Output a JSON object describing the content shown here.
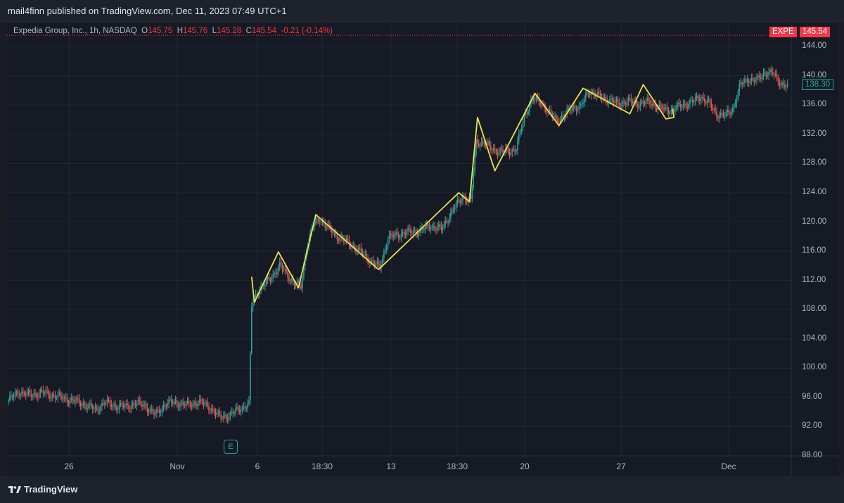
{
  "header": {
    "published": "mail4finn published on TradingView.com, Dec 11, 2023 07:49 UTC+1"
  },
  "legend": {
    "symbol": "Expedia Group, Inc., 1h, NASDAQ",
    "o_label": "O",
    "o": "145.75",
    "h_label": "H",
    "h": "145.76",
    "l_label": "L",
    "l": "145.28",
    "c_label": "C",
    "c": "145.54",
    "change": "-0.21 (-0.14%)"
  },
  "tags": {
    "ticker": "EXPE",
    "last_price": "145.54",
    "cursor_price": "138.30"
  },
  "colors": {
    "up": "#26a69a",
    "down": "#ef5350",
    "zigzag": "#e8e24a",
    "grid": "#232633",
    "price_line": "#f23645"
  },
  "earnings_marker": "E",
  "footer": {
    "brand": "TradingView"
  },
  "chart_data": {
    "type": "candlestick",
    "title": "Expedia Group, Inc., 1h, NASDAQ",
    "y_ticks": [
      "144.00",
      "140.00",
      "136.00",
      "132.00",
      "128.00",
      "124.00",
      "120.00",
      "116.00",
      "112.00",
      "108.00",
      "104.00",
      "100.00",
      "96.00",
      "92.00",
      "88.00"
    ],
    "x_ticks": [
      "26",
      "Nov",
      "6",
      "18:30",
      "13",
      "18:30",
      "20",
      "27",
      "Dec"
    ],
    "ylim": [
      88,
      145.5
    ],
    "last_price": 145.54,
    "approx_close_path": [
      {
        "x": 0,
        "y": 95.6
      },
      {
        "x": 8,
        "y": 96.8
      },
      {
        "x": 16,
        "y": 96.3
      },
      {
        "x": 25,
        "y": 96.7
      },
      {
        "x": 35,
        "y": 96.2
      },
      {
        "x": 45,
        "y": 95.7
      },
      {
        "x": 55,
        "y": 95.2
      },
      {
        "x": 65,
        "y": 94.3
      },
      {
        "x": 72,
        "y": 95.3
      },
      {
        "x": 80,
        "y": 94.8
      },
      {
        "x": 88,
        "y": 94.7
      },
      {
        "x": 95,
        "y": 95.2
      },
      {
        "x": 102,
        "y": 94.9
      },
      {
        "x": 110,
        "y": 93.6
      },
      {
        "x": 118,
        "y": 95.2
      },
      {
        "x": 126,
        "y": 95.3
      },
      {
        "x": 134,
        "y": 94.9
      },
      {
        "x": 142,
        "y": 95.4
      },
      {
        "x": 150,
        "y": 94.8
      },
      {
        "x": 158,
        "y": 93.3
      },
      {
        "x": 166,
        "y": 93.6
      },
      {
        "x": 174,
        "y": 94.6
      },
      {
        "x": 180,
        "y": 95.0
      },
      {
        "x": 182,
        "y": 108.5
      },
      {
        "x": 186,
        "y": 110.5
      },
      {
        "x": 192,
        "y": 111.5
      },
      {
        "x": 198,
        "y": 112.8
      },
      {
        "x": 203,
        "y": 114.0
      },
      {
        "x": 208,
        "y": 113.0
      },
      {
        "x": 214,
        "y": 111.5
      },
      {
        "x": 219,
        "y": 111.2
      },
      {
        "x": 223,
        "y": 116.5
      },
      {
        "x": 228,
        "y": 119.5
      },
      {
        "x": 233,
        "y": 120.5
      },
      {
        "x": 240,
        "y": 119.0
      },
      {
        "x": 248,
        "y": 117.8
      },
      {
        "x": 256,
        "y": 117.0
      },
      {
        "x": 264,
        "y": 115.8
      },
      {
        "x": 272,
        "y": 114.5
      },
      {
        "x": 278,
        "y": 113.8
      },
      {
        "x": 284,
        "y": 117.8
      },
      {
        "x": 292,
        "y": 118.3
      },
      {
        "x": 300,
        "y": 118.6
      },
      {
        "x": 308,
        "y": 118.8
      },
      {
        "x": 316,
        "y": 119.5
      },
      {
        "x": 324,
        "y": 119.0
      },
      {
        "x": 332,
        "y": 121.5
      },
      {
        "x": 340,
        "y": 123.5
      },
      {
        "x": 346,
        "y": 122.8
      },
      {
        "x": 350,
        "y": 131.0
      },
      {
        "x": 356,
        "y": 130.8
      },
      {
        "x": 362,
        "y": 130.0
      },
      {
        "x": 368,
        "y": 129.6
      },
      {
        "x": 374,
        "y": 129.7
      },
      {
        "x": 380,
        "y": 130.0
      },
      {
        "x": 386,
        "y": 134.5
      },
      {
        "x": 392,
        "y": 136.8
      },
      {
        "x": 398,
        "y": 136.5
      },
      {
        "x": 404,
        "y": 135.0
      },
      {
        "x": 410,
        "y": 134.0
      },
      {
        "x": 416,
        "y": 134.5
      },
      {
        "x": 422,
        "y": 135.8
      },
      {
        "x": 428,
        "y": 135.6
      },
      {
        "x": 434,
        "y": 138.0
      },
      {
        "x": 440,
        "y": 137.3
      },
      {
        "x": 448,
        "y": 136.8
      },
      {
        "x": 456,
        "y": 136.2
      },
      {
        "x": 464,
        "y": 136.5
      },
      {
        "x": 472,
        "y": 136.2
      },
      {
        "x": 480,
        "y": 136.4
      },
      {
        "x": 488,
        "y": 135.5
      },
      {
        "x": 496,
        "y": 135.3
      },
      {
        "x": 504,
        "y": 136.0
      },
      {
        "x": 512,
        "y": 136.4
      },
      {
        "x": 518,
        "y": 137.2
      },
      {
        "x": 524,
        "y": 136.2
      },
      {
        "x": 530,
        "y": 134.8
      },
      {
        "x": 536,
        "y": 134.5
      },
      {
        "x": 542,
        "y": 135.5
      },
      {
        "x": 548,
        "y": 138.8
      },
      {
        "x": 554,
        "y": 139.6
      },
      {
        "x": 560,
        "y": 139.3
      },
      {
        "x": 566,
        "y": 140.5
      },
      {
        "x": 572,
        "y": 140.3
      },
      {
        "x": 578,
        "y": 139.0
      },
      {
        "x": 584,
        "y": 138.4
      }
    ],
    "zigzag": [
      {
        "x": 182,
        "y": 112.5
      },
      {
        "x": 184,
        "y": 109.0
      },
      {
        "x": 202,
        "y": 115.9
      },
      {
        "x": 217,
        "y": 111.0
      },
      {
        "x": 230,
        "y": 121.0
      },
      {
        "x": 277,
        "y": 113.5
      },
      {
        "x": 337,
        "y": 124.0
      },
      {
        "x": 345,
        "y": 122.8
      },
      {
        "x": 351,
        "y": 134.3
      },
      {
        "x": 364,
        "y": 127.0
      },
      {
        "x": 394,
        "y": 137.6
      },
      {
        "x": 412,
        "y": 133.2
      },
      {
        "x": 430,
        "y": 138.3
      },
      {
        "x": 465,
        "y": 134.8
      },
      {
        "x": 475,
        "y": 138.8
      },
      {
        "x": 492,
        "y": 134.1
      },
      {
        "x": 498,
        "y": 134.3
      },
      {
        "x": 497,
        "y": 135.5
      }
    ]
  }
}
